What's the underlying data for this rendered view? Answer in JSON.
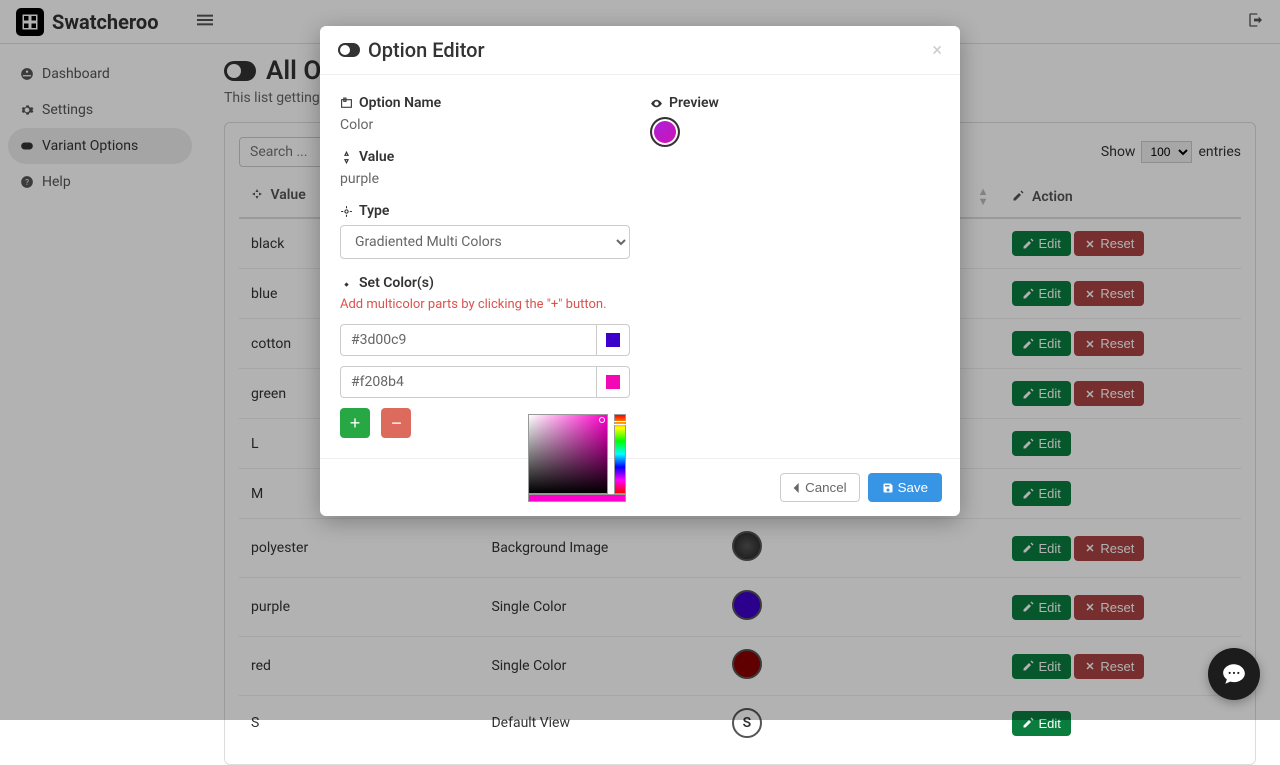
{
  "app": {
    "name": "Swatcheroo"
  },
  "sidebar": {
    "items": [
      {
        "label": "Dashboard"
      },
      {
        "label": "Settings"
      },
      {
        "label": "Variant Options"
      },
      {
        "label": "Help"
      }
    ]
  },
  "page": {
    "title": "All Options",
    "subtitle": "This list getting from "
  },
  "table": {
    "search_placeholder": "Search ...",
    "show_label": "Show",
    "entries_label": "entries",
    "page_size": "100",
    "headers": {
      "value": "Value",
      "action": "Action"
    },
    "edit": "Edit",
    "reset": "Reset",
    "rows": [
      {
        "value": "black",
        "type": "",
        "swatch_bg": "",
        "swatch_text": "",
        "reset": true
      },
      {
        "value": "blue",
        "type": "",
        "swatch_bg": "",
        "swatch_text": "",
        "reset": true
      },
      {
        "value": "cotton",
        "type": "",
        "swatch_bg": "",
        "swatch_text": "",
        "reset": true
      },
      {
        "value": "green",
        "type": "",
        "swatch_bg": "",
        "swatch_text": "",
        "reset": true
      },
      {
        "value": "L",
        "type": "",
        "swatch_bg": "",
        "swatch_text": "",
        "reset": false
      },
      {
        "value": "M",
        "type": "",
        "swatch_bg": "",
        "swatch_text": "",
        "reset": false
      },
      {
        "value": "polyester",
        "type": "Background Image",
        "swatch_bg": "radial-gradient(circle,#555,#222)",
        "swatch_text": "",
        "reset": true
      },
      {
        "value": "purple",
        "type": "Single Color",
        "swatch_bg": "#3d00c9",
        "swatch_text": "",
        "reset": true
      },
      {
        "value": "red",
        "type": "Single Color",
        "swatch_bg": "#8b0000",
        "swatch_text": "",
        "reset": true
      },
      {
        "value": "S",
        "type": "Default View",
        "swatch_bg": "#fff",
        "swatch_text": "S",
        "reset": false
      }
    ]
  },
  "modal": {
    "title": "Option Editor",
    "labels": {
      "option_name": "Option Name",
      "value": "Value",
      "type": "Type",
      "set_colors": "Set Color(s)",
      "preview": "Preview"
    },
    "option_name": "Color",
    "value": "purple",
    "type": "Gradiented Multi Colors",
    "helper": "Add multicolor parts by clicking the \"+\" button.",
    "colors": [
      {
        "hex": "#3d00c9"
      },
      {
        "hex": "#f208b4"
      }
    ],
    "cancel": "Cancel",
    "save": "Save"
  }
}
